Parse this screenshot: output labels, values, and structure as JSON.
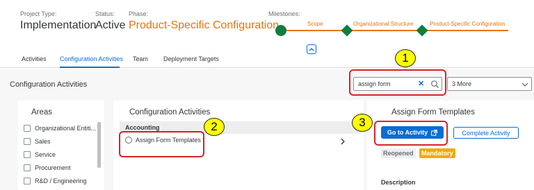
{
  "header": {
    "project_type_label": "Project Type:",
    "project_type_value": "Implementation",
    "status_label": "Status:",
    "status_value": "Active",
    "phase_label": "Phase:",
    "phase_value": "Product-Specific Configuration",
    "milestones_label": "Milestones:",
    "milestones": [
      "Scope",
      "Organizational Structure",
      "Product-Specific Configuration"
    ]
  },
  "tabs": [
    "Activities",
    "Configuration Activities",
    "Team",
    "Deployment Targets"
  ],
  "toolbar": {
    "title": "Configuration Activities",
    "search_value": "assign form",
    "filter_value": "3 More"
  },
  "areas": {
    "title": "Areas",
    "items": [
      "Organizational Entiti...",
      "Sales",
      "Service",
      "Procurement",
      "R&D / Engineering"
    ]
  },
  "config": {
    "title": "Configuration Activities",
    "group": "Accounting",
    "item": "Assign Form Templates",
    "required_mark": "*"
  },
  "detail": {
    "title": "Assign Form Templates",
    "go_button": "Go to Activity",
    "complete_button": "Complete Activity",
    "badge_reopened": "Reopened",
    "badge_mandatory": "Mandatory",
    "description_label": "Description"
  },
  "annotations": [
    "1",
    "2",
    "3"
  ],
  "colors": {
    "accent": "#0a6ed1",
    "phase": "#e9730c",
    "milestone_done": "#107e3e",
    "annotation_fill": "#ffff00",
    "annotation_border": "#d8232a"
  }
}
